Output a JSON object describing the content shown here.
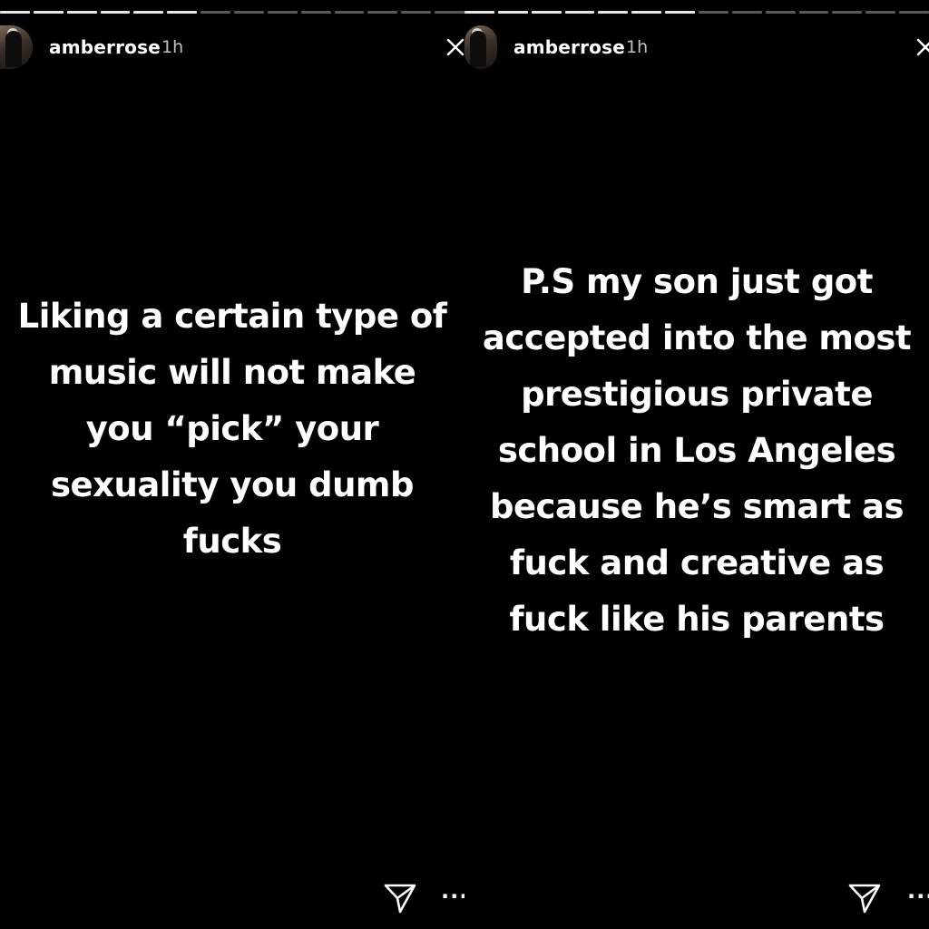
{
  "stories": [
    {
      "username": "amberrose",
      "time": "1h",
      "text": "Liking a certain type of\nmusic will not make\nyou “pick” your\nsexuality you dumb\nfucks",
      "progress": {
        "segments": 14,
        "completed": 6
      },
      "icons": {
        "avatar": "profile-avatar",
        "close": "close-icon",
        "share": "send-icon",
        "more": "more-icon"
      }
    },
    {
      "username": "amberrose",
      "time": "1h",
      "text": "P.S my son just got\naccepted into the most\nprestigious private\nschool in Los Angeles\nbecause he’s smart as\nfuck and creative as\nfuck  like his parents",
      "progress": {
        "segments": 14,
        "completed": 7
      },
      "icons": {
        "avatar": "profile-avatar",
        "close": "close-icon",
        "share": "send-icon",
        "more": "more-icon"
      }
    }
  ],
  "more_glyph": "···",
  "colors": {
    "background": "#000000",
    "text": "#ffffff"
  }
}
